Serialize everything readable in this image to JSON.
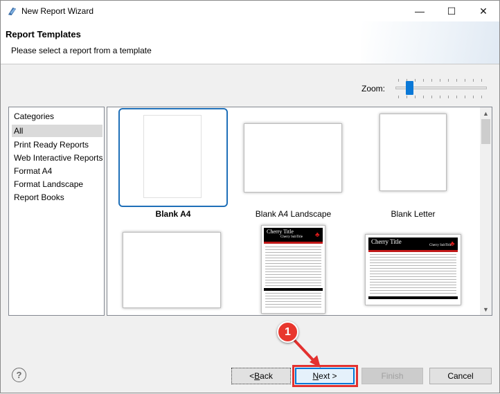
{
  "window": {
    "title": "New Report Wizard",
    "minimize_glyph": "—",
    "maximize_glyph": "☐",
    "close_glyph": "✕"
  },
  "header": {
    "title": "Report Templates",
    "subtitle": "Please select a report from a template"
  },
  "zoom": {
    "label": "Zoom:",
    "level_fraction": 0.12
  },
  "categories": {
    "items": [
      {
        "label": "Categories",
        "selected": false
      },
      {
        "label": "All",
        "selected": true
      },
      {
        "label": "Print Ready Reports",
        "selected": false
      },
      {
        "label": "Web Interactive Reports",
        "selected": false
      },
      {
        "label": "Format A4",
        "selected": false
      },
      {
        "label": "Format Landscape",
        "selected": false
      },
      {
        "label": "Report Books",
        "selected": false
      }
    ]
  },
  "templates": {
    "items": [
      {
        "label": "Blank A4",
        "selected": true
      },
      {
        "label": "Blank A4 Landscape",
        "selected": false
      },
      {
        "label": "Blank Letter",
        "selected": false
      },
      {
        "label": "",
        "selected": false
      },
      {
        "label": "",
        "selected": false,
        "preview_title": "Cherry Title",
        "preview_subtitle": "Cherry SubTitle"
      },
      {
        "label": "",
        "selected": false,
        "preview_title": "Cherry Title",
        "preview_subtitle": "Cherry SubTitle"
      }
    ]
  },
  "footer": {
    "help_glyph": "?",
    "back_label": "< Back",
    "back_prefix": "< ",
    "back_mnemonic": "B",
    "back_rest": "ack",
    "next_mnemonic": "N",
    "next_rest": "ext >",
    "finish_label": "Finish",
    "cancel_label": "Cancel"
  },
  "callout": {
    "number": "1",
    "color": "#e8362d"
  },
  "colors": {
    "selection": "#1e6fb8",
    "accent": "#0078d7",
    "cherry_red": "#c01818"
  }
}
